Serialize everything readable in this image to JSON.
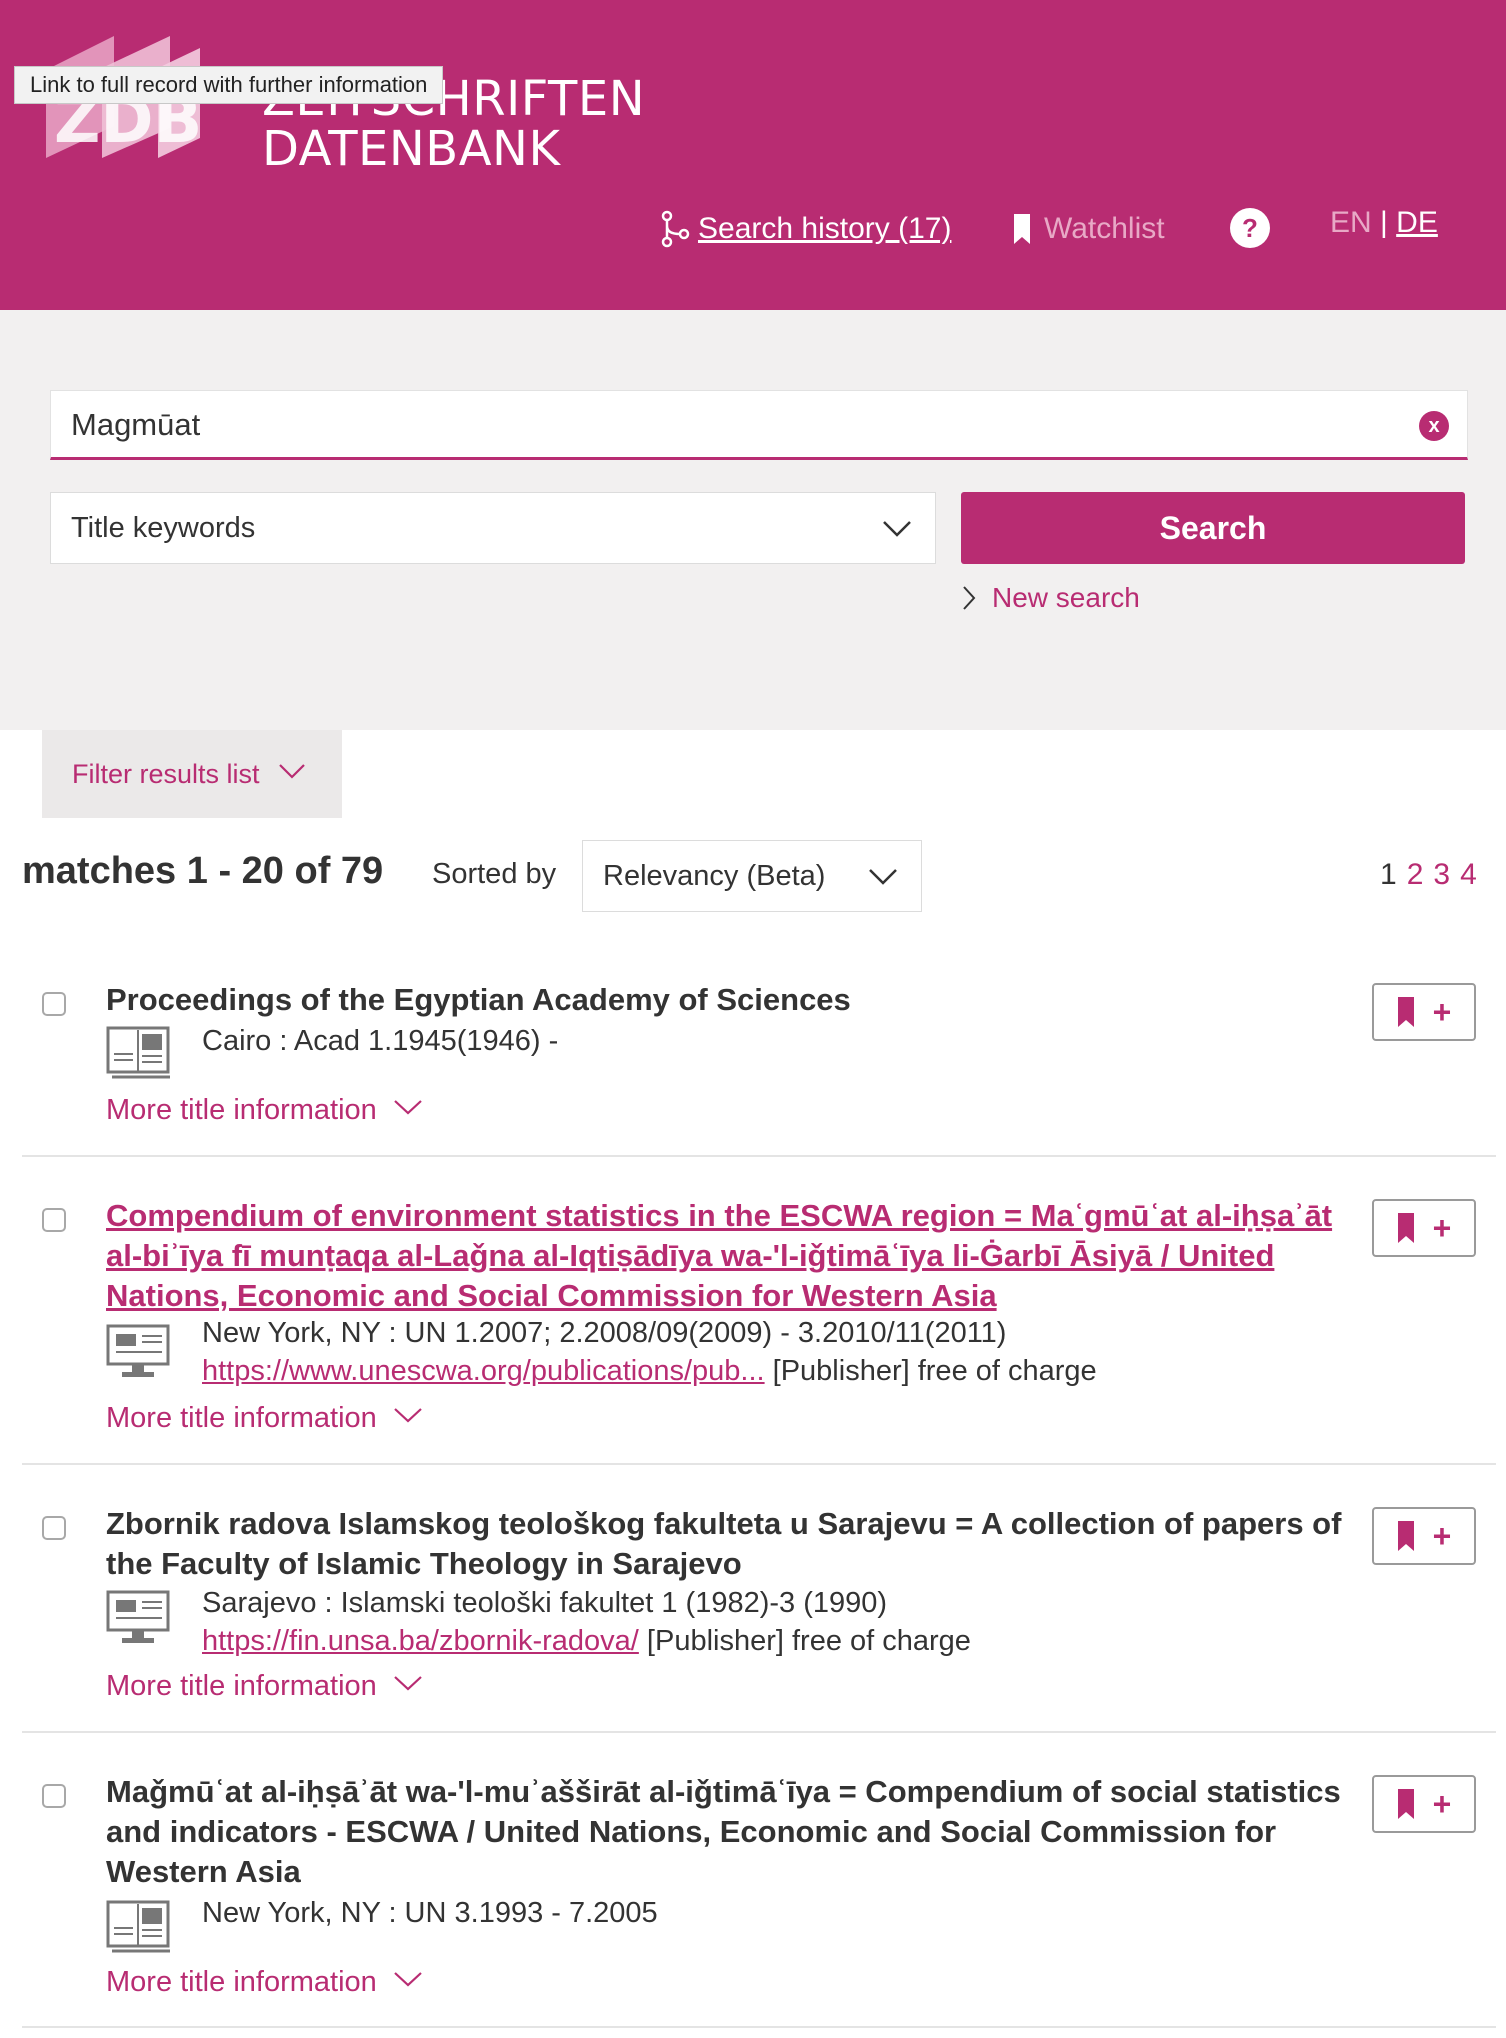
{
  "header": {
    "logo_line1": "ZEITSCHRIFTEN",
    "logo_line2": "DATENBANK",
    "tooltip": "Link to full record with further information",
    "search_history_label": "Search history (17)",
    "watchlist_label": "Watchlist",
    "help_label": "?",
    "lang_en": "EN",
    "lang_sep": "|",
    "lang_de": "DE"
  },
  "search": {
    "query": "Magmūat",
    "clear_label": "x",
    "field_selected": "Title keywords",
    "search_button": "Search",
    "new_search_label": "New search"
  },
  "results_header": {
    "filter_label": "Filter results list",
    "matches_label": "matches 1 - 20  of 79",
    "sorted_by_label": "Sorted by",
    "sort_selected": "Relevancy (Beta)",
    "pages": [
      "1",
      "2",
      "3",
      "4"
    ],
    "current_page": "1"
  },
  "results": [
    {
      "title": "Proceedings of the Egyptian Academy of Sciences",
      "title_is_link": false,
      "media_icon": "print-journal-icon",
      "publication": "Cairo : Acad 1.1945(1946) -",
      "more_label": "More title information"
    },
    {
      "title": "Compendium of environment statistics in the ESCWA region = Maʿgmūʿat al-iḥṣaʾāt al-biʾīya fī munṭaqa al-Laǧna al-Iqtiṣādīya wa-'l-iǧtimāʿīya li-Ġarbī Āsiyā / United Nations, Economic and Social Commission for Western Asia",
      "title_is_link": true,
      "media_icon": "online-resource-icon",
      "publication": "New York, NY : UN 1.2007; 2.2008/09(2009) - 3.2010/11(2011)",
      "access_url": "https://www.unescwa.org/publications/pub...",
      "access_note": " [Publisher] free of charge",
      "more_label": "More title information"
    },
    {
      "title": "Zbornik radova Islamskog teološkog fakulteta u Sarajevu = A collection of papers of the Faculty of Islamic Theology in Sarajevo",
      "title_is_link": false,
      "media_icon": "online-resource-icon",
      "publication": "Sarajevo : Islamski teološki fakultet 1 (1982)-3 (1990)",
      "access_url": "https://fin.unsa.ba/zbornik-radova/",
      "access_note": " [Publisher] free of charge",
      "more_label": "More title information"
    },
    {
      "title": "Maǧmūʿat al-iḥṣāʾāt wa-'l-muʾašširāt al-iǧtimāʿīya = Compendium of social statistics and indicators - ESCWA / United Nations, Economic and Social Commission for Western Asia",
      "title_is_link": false,
      "media_icon": "print-journal-icon",
      "publication": "New York, NY : UN 3.1993 - 7.2005",
      "more_label": "More title information"
    }
  ],
  "colors": {
    "brand": "#b82c72",
    "panel_bg": "#f2f0f0",
    "text": "#333333"
  }
}
